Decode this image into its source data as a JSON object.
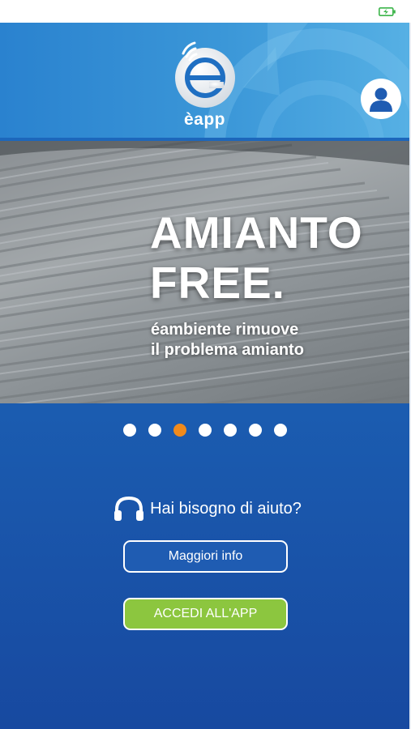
{
  "status_bar": {
    "battery_icon": "battery-charging-icon",
    "battery_color": "#3cb54a"
  },
  "header": {
    "logo_icon": "eapp-logo-icon",
    "app_name": "èapp",
    "user_icon": "user-profile-icon"
  },
  "banner": {
    "title_line1": "AMIANTO",
    "title_line2": "FREE.",
    "subtitle_line1": "éambiente rimuove",
    "subtitle_line2": "il problema amianto"
  },
  "carousel": {
    "total": 7,
    "active_index": 2,
    "active_color": "#f08a1c"
  },
  "help": {
    "icon": "headphones-icon",
    "text": "Hai bisogno di aiuto?"
  },
  "buttons": {
    "info_label": "Maggiori info",
    "access_label": "ACCEDI ALL'APP",
    "access_color": "#8cc63f"
  }
}
